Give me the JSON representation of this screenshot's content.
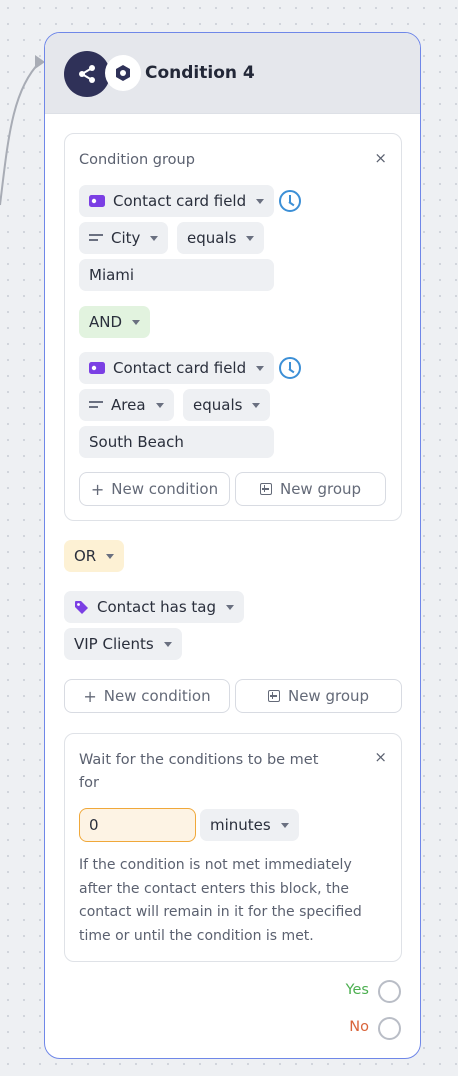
{
  "node": {
    "title": "Condition 4"
  },
  "group1": {
    "label": "Condition group",
    "condition1": {
      "field_label": "Contact card field",
      "subfield": "City",
      "operator": "equals",
      "value": "Miami"
    },
    "connector": "AND",
    "condition2": {
      "field_label": "Contact card field",
      "subfield": "Area",
      "operator": "equals",
      "value": "South Beach"
    },
    "new_condition": "New condition",
    "new_group": "New group"
  },
  "or_connector": "OR",
  "tag_condition": {
    "label": "Contact has tag",
    "value": "VIP Clients"
  },
  "outer_buttons": {
    "new_condition": "New condition",
    "new_group": "New group"
  },
  "wait_box": {
    "label": "Wait for the conditions to be met for",
    "amount": "0",
    "unit": "minutes",
    "info": "If the condition is not met immediately after the contact enters this block, the contact will remain in it for the specified time or until the condition is met."
  },
  "outputs": {
    "yes": "Yes",
    "no": "No"
  },
  "colors": {
    "yes": "#4caf50",
    "no": "#d9643a",
    "node_border": "#6f87e8",
    "accent_purple": "#7b3fe4"
  },
  "icons": {
    "close": "×",
    "plus": "+"
  }
}
